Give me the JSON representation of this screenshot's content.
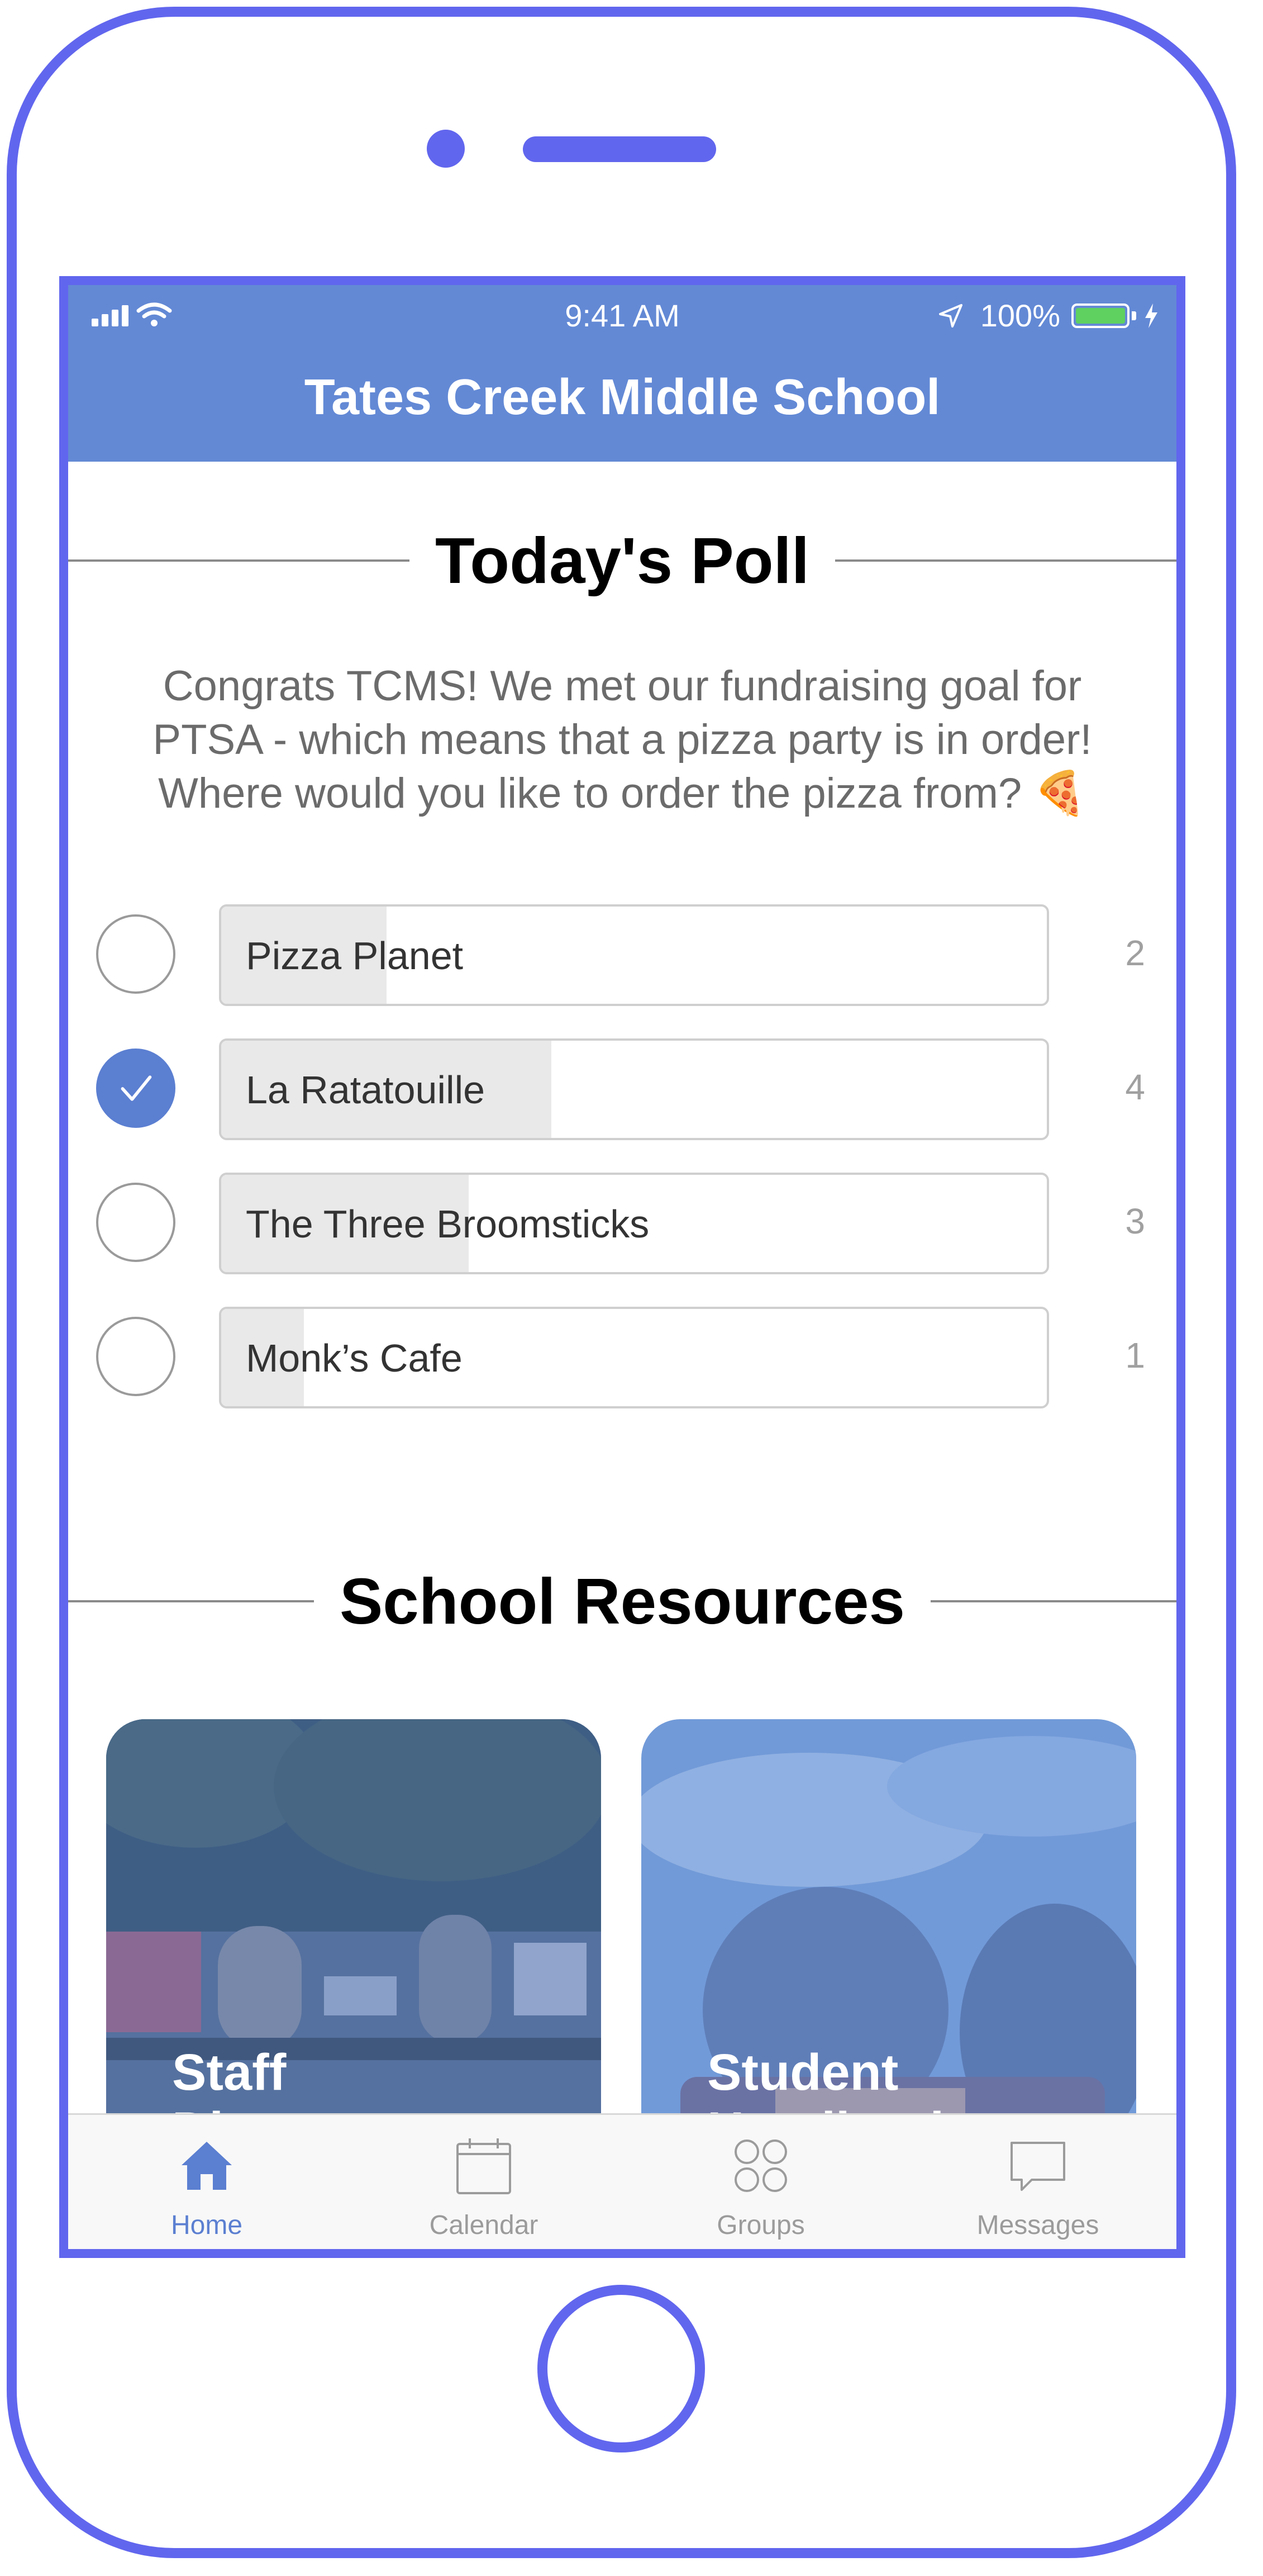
{
  "status_bar": {
    "time": "9:41 AM",
    "battery": "100%"
  },
  "header": {
    "title": "Tates Creek Middle School"
  },
  "poll": {
    "heading": "Today's Poll",
    "question": "Congrats TCMS! We met our fundraising goal for PTSA - which means that a pizza party is in order! Where would you like to order the pizza from? 🍕",
    "options": [
      {
        "label": "Pizza Planet",
        "count": "2",
        "selected": false,
        "share": 0.2
      },
      {
        "label": "La Ratatouille",
        "count": "4",
        "selected": true,
        "share": 0.4
      },
      {
        "label": "The Three Broomsticks",
        "count": "3",
        "selected": false,
        "share": 0.3
      },
      {
        "label": "Monk’s Cafe",
        "count": "1",
        "selected": false,
        "share": 0.1
      }
    ]
  },
  "resources": {
    "heading": "School Resources",
    "cards": [
      {
        "label": "Staff Directory"
      },
      {
        "label": "Student Handbook"
      }
    ]
  },
  "tab_bar": {
    "tabs": [
      {
        "label": "Home",
        "icon": "home-icon",
        "active": true
      },
      {
        "label": "Calendar",
        "icon": "calendar-icon",
        "active": false
      },
      {
        "label": "Groups",
        "icon": "groups-icon",
        "active": false
      },
      {
        "label": "Messages",
        "icon": "messages-icon",
        "active": false
      }
    ]
  },
  "colors": {
    "frame": "#6166ee",
    "header": "#6389d5",
    "accent": "#5b7fd1",
    "battery": "#5ed161"
  }
}
